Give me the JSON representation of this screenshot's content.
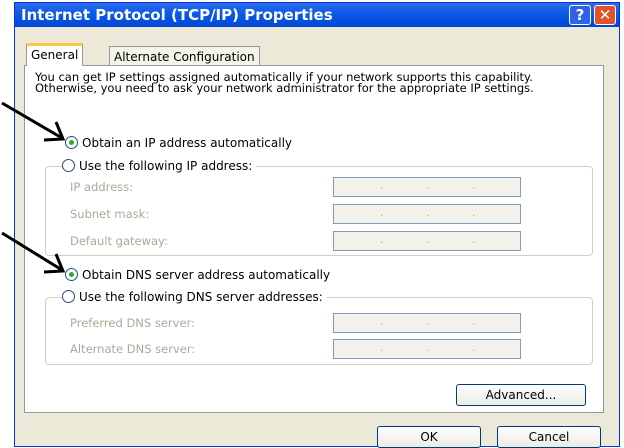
{
  "window": {
    "title": "Internet Protocol (TCP/IP) Properties",
    "help_label": "?",
    "close_label": "✕"
  },
  "tabs": [
    {
      "label": "General"
    },
    {
      "label": "Alternate Configuration"
    }
  ],
  "description": "You can get IP settings assigned automatically if your network supports this capability. Otherwise, you need to ask your network administrator for the appropriate IP settings.",
  "ip": {
    "auto_label": "Obtain an IP address automatically",
    "manual_label": "Use the following IP address:",
    "selected": "auto",
    "fields": [
      {
        "label": "IP address:"
      },
      {
        "label": "Subnet mask:"
      },
      {
        "label": "Default gateway:"
      }
    ]
  },
  "dns": {
    "auto_label": "Obtain DNS server address automatically",
    "manual_label": "Use the following DNS server addresses:",
    "selected": "auto",
    "fields": [
      {
        "label": "Preferred DNS server:"
      },
      {
        "label": "Alternate DNS server:"
      }
    ]
  },
  "buttons": {
    "advanced": "Advanced...",
    "ok": "OK",
    "cancel": "Cancel"
  },
  "colors": {
    "title_bar": "#0346D6",
    "dialog_bg": "#ECE9D8",
    "selected_radio": "#2FA82F",
    "close": "#E0522A"
  },
  "annotations": [
    "arrow-pointing-to-ip-auto",
    "arrow-pointing-to-dns-auto"
  ]
}
